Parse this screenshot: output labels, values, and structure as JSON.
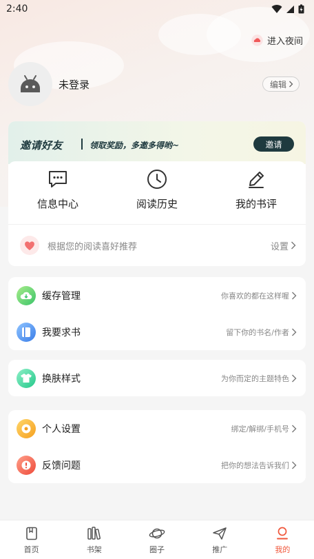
{
  "status_bar": {
    "time": "2:40"
  },
  "night_mode": {
    "label": "进入夜间"
  },
  "profile": {
    "login_text": "未登录",
    "edit_label": "编辑"
  },
  "invite": {
    "title": "邀请好友",
    "subtitle": "领取奖励，多邀多得哟~",
    "button": "邀请"
  },
  "quick": [
    {
      "label": "信息中心",
      "icon": "message-icon"
    },
    {
      "label": "阅读历史",
      "icon": "clock-icon"
    },
    {
      "label": "我的书评",
      "icon": "pencil-icon"
    }
  ],
  "recommend": {
    "text": "根据您的阅读喜好推荐",
    "action": "设置"
  },
  "menu_group1": [
    {
      "label": "缓存管理",
      "hint": "你喜欢的都在这样喔",
      "icon": "cloud-download-icon",
      "color": "#5bcf7a"
    },
    {
      "label": "我要求书",
      "hint": "留下你的书名/作者",
      "icon": "book-icon",
      "color": "#4a8ff0"
    }
  ],
  "menu_group2": [
    {
      "label": "换肤样式",
      "hint": "为你而定的主题特色",
      "icon": "shirt-icon",
      "color": "#3fd6a0"
    }
  ],
  "menu_group3": [
    {
      "label": "个人设置",
      "hint": "绑定/解绑/手机号",
      "icon": "settings-icon",
      "color": "#f5b030"
    },
    {
      "label": "反馈问题",
      "hint": "把你的想法告诉我们",
      "icon": "feedback-icon",
      "color": "#f06a50"
    }
  ],
  "tabs": [
    {
      "label": "首页",
      "icon": "home-book-icon",
      "active": false
    },
    {
      "label": "书架",
      "icon": "bookshelf-icon",
      "active": false
    },
    {
      "label": "圈子",
      "icon": "planet-icon",
      "active": false
    },
    {
      "label": "推广",
      "icon": "paper-plane-icon",
      "active": false
    },
    {
      "label": "我的",
      "icon": "profile-icon",
      "active": true
    }
  ],
  "colors": {
    "accent": "#f0563a",
    "invite_dark": "#1f3a3f"
  }
}
